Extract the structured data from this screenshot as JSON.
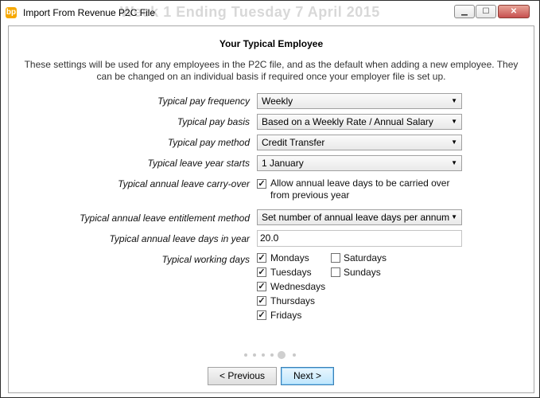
{
  "window": {
    "title": "Import From Revenue P2C File",
    "app_icon": "bp",
    "background_text": "Week 1 Ending Tuesday 7 April 2015"
  },
  "page": {
    "heading": "Your Typical Employee",
    "description": "These settings will be used for any employees in the P2C file, and as the default when adding a new employee. They can be changed on an individual basis if required once your employer file is set up."
  },
  "fields": {
    "pay_frequency": {
      "label": "Typical pay frequency",
      "value": "Weekly"
    },
    "pay_basis": {
      "label": "Typical pay basis",
      "value": "Based on a Weekly Rate / Annual Salary"
    },
    "pay_method": {
      "label": "Typical pay method",
      "value": "Credit Transfer"
    },
    "leave_year_starts": {
      "label": "Typical leave year starts",
      "value": "1 January"
    },
    "carry_over": {
      "label": "Typical annual leave carry-over",
      "checkbox_label": "Allow annual leave days to be carried over from previous year",
      "checked": true
    },
    "entitlement_method": {
      "label": "Typical annual leave entitlement method",
      "value": "Set number of annual leave days per annum"
    },
    "leave_days": {
      "label": "Typical annual leave days in year",
      "value": "20.0"
    },
    "working_days": {
      "label": "Typical working days",
      "days": [
        {
          "name": "Mondays",
          "checked": true
        },
        {
          "name": "Tuesdays",
          "checked": true
        },
        {
          "name": "Wednesdays",
          "checked": true
        },
        {
          "name": "Thursdays",
          "checked": true
        },
        {
          "name": "Fridays",
          "checked": true
        },
        {
          "name": "Saturdays",
          "checked": false
        },
        {
          "name": "Sundays",
          "checked": false
        }
      ]
    }
  },
  "wizard": {
    "total_steps": 6,
    "current_step": 5
  },
  "buttons": {
    "previous": "< Previous",
    "next": "Next >"
  },
  "icons": {
    "dropdown": "▼",
    "check": "✓",
    "minimize": "▁",
    "maximize": "☐",
    "close": "✕"
  },
  "colors": {
    "accent": "#f6a800",
    "primary_button": "#bee6fd"
  }
}
